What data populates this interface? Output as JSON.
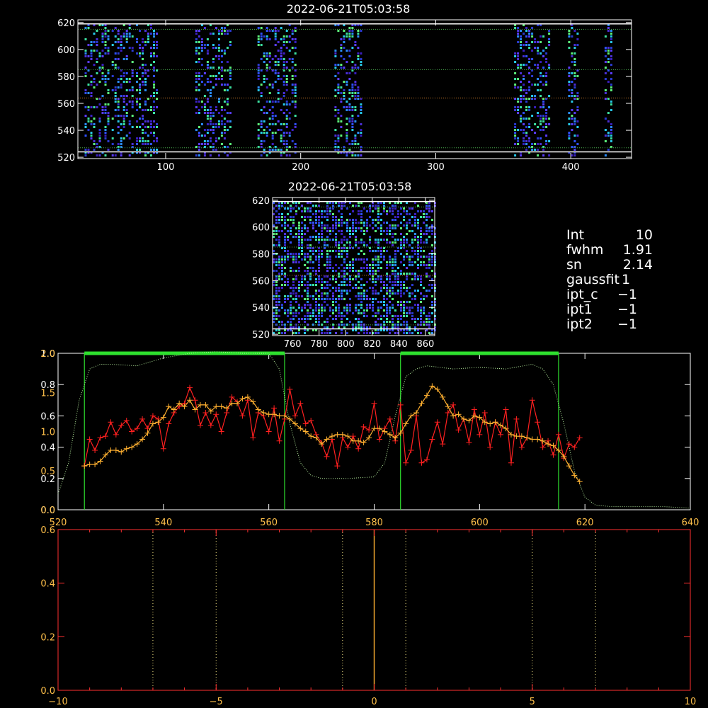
{
  "panel_top": {
    "title": "2022-06-21T05:03:58",
    "xlim": [
      35,
      445
    ],
    "ylim": [
      519,
      622
    ],
    "xticks": [
      100,
      200,
      300,
      400
    ],
    "yticks": [
      520,
      540,
      560,
      580,
      600,
      620
    ],
    "hlines_white": [
      524,
      619
    ],
    "hlines_green_dotted": [
      527,
      585,
      615
    ],
    "hline_orange_dotted": 564,
    "column_bands": [
      [
        40,
        58
      ],
      [
        60,
        75
      ],
      [
        78,
        93
      ],
      [
        122,
        148
      ],
      [
        168,
        197
      ],
      [
        225,
        244
      ],
      [
        358,
        385
      ],
      [
        398,
        406
      ],
      [
        425,
        430
      ]
    ]
  },
  "panel_mid": {
    "title": "2022-06-21T05:03:58",
    "xlim": [
      745,
      867
    ],
    "ylim": [
      519,
      622
    ],
    "xticks": [
      760,
      780,
      800,
      820,
      840,
      860
    ],
    "yticks": [
      520,
      540,
      560,
      580,
      600,
      620
    ],
    "hlines_white": [
      524,
      619
    ],
    "hlines_green_dotted": [
      527,
      585,
      615
    ],
    "hline_orange_dotted": 564
  },
  "info": {
    "rows": [
      {
        "key": "Int",
        "value": "10"
      },
      {
        "key": "fwhm",
        "value": "1.91"
      },
      {
        "key": "sn",
        "value": "2.14"
      },
      {
        "key": "gaussfit",
        "value": "1"
      },
      {
        "key": "ipt_c",
        "value": "−1"
      },
      {
        "key": "ipt1",
        "value": "−1"
      },
      {
        "key": "ipt2",
        "value": "−1"
      }
    ]
  },
  "chart_data": [
    {
      "type": "line",
      "xlim": [
        520,
        640
      ],
      "ylim": [
        0,
        1.0
      ],
      "xticks": [
        520,
        540,
        560,
        580,
        600,
        620,
        640
      ],
      "yticks_left_a": [
        "0.0",
        "0.2",
        "0.4",
        "0.6",
        "0.8",
        "1.0"
      ],
      "yticks_left_b": [
        "0.0",
        "0.5",
        "1.0",
        "1.5",
        "2.0"
      ],
      "window_lines": [
        525,
        563,
        585,
        615
      ],
      "series_red": {
        "x": [
          525,
          526,
          527,
          528,
          529,
          530,
          531,
          532,
          533,
          534,
          535,
          536,
          537,
          538,
          539,
          540,
          541,
          542,
          543,
          544,
          545,
          546,
          547,
          548,
          549,
          550,
          551,
          552,
          553,
          554,
          555,
          556,
          557,
          558,
          559,
          560,
          561,
          562,
          563,
          564,
          565,
          566,
          567,
          568,
          569,
          570,
          571,
          572,
          573,
          574,
          575,
          576,
          577,
          578,
          579,
          580,
          581,
          582,
          583,
          584,
          585,
          586,
          587,
          588,
          589,
          590,
          591,
          592,
          593,
          594,
          595,
          596,
          597,
          598,
          599,
          600,
          601,
          602,
          603,
          604,
          605,
          606,
          607,
          608,
          609,
          610,
          611,
          612,
          613,
          614,
          615,
          616,
          617,
          618,
          619
        ],
        "y": [
          0.28,
          0.45,
          0.38,
          0.46,
          0.47,
          0.56,
          0.48,
          0.54,
          0.57,
          0.5,
          0.52,
          0.58,
          0.52,
          0.6,
          0.58,
          0.39,
          0.55,
          0.62,
          0.66,
          0.68,
          0.78,
          0.7,
          0.54,
          0.62,
          0.54,
          0.61,
          0.5,
          0.62,
          0.72,
          0.69,
          0.6,
          0.7,
          0.46,
          0.62,
          0.6,
          0.5,
          0.65,
          0.44,
          0.58,
          0.77,
          0.6,
          0.68,
          0.55,
          0.57,
          0.48,
          0.43,
          0.34,
          0.45,
          0.28,
          0.46,
          0.4,
          0.47,
          0.39,
          0.53,
          0.51,
          0.68,
          0.45,
          0.52,
          0.58,
          0.44,
          0.67,
          0.3,
          0.38,
          0.6,
          0.3,
          0.32,
          0.45,
          0.56,
          0.42,
          0.62,
          0.67,
          0.51,
          0.58,
          0.43,
          0.64,
          0.48,
          0.62,
          0.4,
          0.56,
          0.48,
          0.64,
          0.3,
          0.58,
          0.4,
          0.46,
          0.7,
          0.56,
          0.4,
          0.44,
          0.35,
          0.48,
          0.33,
          0.42,
          0.4,
          0.46
        ]
      },
      "series_orange": {
        "x": [
          525,
          526,
          527,
          528,
          529,
          530,
          531,
          532,
          533,
          534,
          535,
          536,
          537,
          538,
          539,
          540,
          541,
          542,
          543,
          544,
          545,
          546,
          547,
          548,
          549,
          550,
          551,
          552,
          553,
          554,
          555,
          556,
          557,
          558,
          559,
          560,
          561,
          562,
          563,
          564,
          565,
          566,
          567,
          568,
          569,
          570,
          571,
          572,
          573,
          574,
          575,
          576,
          577,
          578,
          579,
          580,
          581,
          582,
          583,
          584,
          585,
          586,
          587,
          588,
          589,
          590,
          591,
          592,
          593,
          594,
          595,
          596,
          597,
          598,
          599,
          600,
          601,
          602,
          603,
          604,
          605,
          606,
          607,
          608,
          609,
          610,
          611,
          612,
          613,
          614,
          615,
          616,
          617,
          618,
          619
        ],
        "y": [
          0.28,
          0.29,
          0.29,
          0.31,
          0.35,
          0.38,
          0.38,
          0.37,
          0.39,
          0.4,
          0.42,
          0.45,
          0.49,
          0.55,
          0.56,
          0.59,
          0.66,
          0.64,
          0.68,
          0.66,
          0.7,
          0.64,
          0.67,
          0.67,
          0.63,
          0.66,
          0.66,
          0.65,
          0.68,
          0.68,
          0.71,
          0.72,
          0.69,
          0.64,
          0.62,
          0.61,
          0.61,
          0.6,
          0.6,
          0.58,
          0.55,
          0.52,
          0.5,
          0.47,
          0.46,
          0.42,
          0.45,
          0.47,
          0.48,
          0.48,
          0.47,
          0.44,
          0.44,
          0.43,
          0.46,
          0.52,
          0.52,
          0.5,
          0.48,
          0.46,
          0.49,
          0.55,
          0.6,
          0.62,
          0.68,
          0.73,
          0.79,
          0.77,
          0.72,
          0.66,
          0.6,
          0.61,
          0.58,
          0.57,
          0.6,
          0.59,
          0.56,
          0.55,
          0.56,
          0.54,
          0.52,
          0.48,
          0.47,
          0.47,
          0.46,
          0.45,
          0.45,
          0.44,
          0.42,
          0.41,
          0.38,
          0.34,
          0.28,
          0.22,
          0.18
        ]
      },
      "series_green_dotted": {
        "x": [
          520,
          522,
          524,
          526,
          528,
          530,
          535,
          540,
          545,
          550,
          555,
          560,
          562,
          564,
          566,
          568,
          570,
          575,
          580,
          582,
          584,
          586,
          588,
          590,
          595,
          600,
          605,
          610,
          612,
          614,
          616,
          618,
          620,
          622,
          625,
          630,
          635,
          640
        ],
        "y": [
          0.1,
          0.3,
          0.7,
          0.9,
          0.93,
          0.93,
          0.92,
          0.97,
          1.0,
          1.01,
          1.0,
          1.0,
          0.9,
          0.55,
          0.3,
          0.22,
          0.2,
          0.2,
          0.21,
          0.3,
          0.6,
          0.85,
          0.9,
          0.92,
          0.9,
          0.91,
          0.9,
          0.93,
          0.9,
          0.8,
          0.55,
          0.25,
          0.08,
          0.03,
          0.02,
          0.02,
          0.02,
          0.01
        ]
      },
      "green_bars": [
        [
          525,
          563
        ],
        [
          585,
          615
        ]
      ]
    },
    {
      "type": "line",
      "xlim": [
        -10,
        10
      ],
      "ylim": [
        0,
        0.6
      ],
      "xticks": [
        "−10",
        "−5",
        "0",
        "5",
        "10"
      ],
      "xtick_values": [
        -10,
        -5,
        0,
        5,
        10
      ],
      "yticks": [
        "0.0",
        "0.2",
        "0.4",
        "0.6"
      ],
      "ytick_values": [
        0,
        0.2,
        0.4,
        0.6
      ],
      "dotted_vlines": [
        -7,
        -5,
        -1,
        1,
        5,
        7
      ],
      "solid_vline": 0
    }
  ]
}
